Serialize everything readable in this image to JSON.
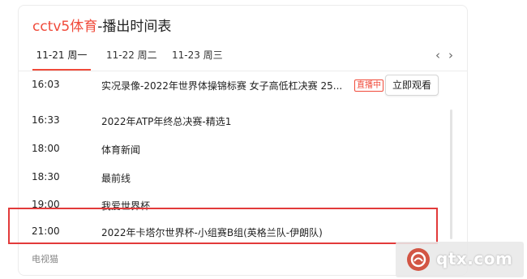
{
  "header": {
    "channel": "cctv5体育",
    "rest": "-播出时间表"
  },
  "tabs": [
    {
      "label": "11-21 周一"
    },
    {
      "label": "11-22 周二"
    },
    {
      "label": "11-23 周三"
    }
  ],
  "nav": {
    "prev": "‹",
    "next": "›"
  },
  "schedule": [
    {
      "time": "16:03",
      "title": "实况录像-2022年世界体操锦标赛 女子高低杠决赛 25...",
      "live_badge": "直播中",
      "watch_label": "立即观看"
    },
    {
      "time": "16:33",
      "title": "2022年ATP年终总决赛-精选1"
    },
    {
      "time": "18:00",
      "title": "体育新闻"
    },
    {
      "time": "18:30",
      "title": "最前线"
    },
    {
      "time": "19:00",
      "title": "我爱世界杯"
    },
    {
      "time": "21:00",
      "title": "2022年卡塔尔世界杯-小组赛B组(英格兰队-伊朗队)"
    }
  ],
  "source": "电视猫",
  "watermark": {
    "text": "qtx.com"
  },
  "colors": {
    "accent": "#f04a3a",
    "highlight_border": "#e23a3a"
  }
}
